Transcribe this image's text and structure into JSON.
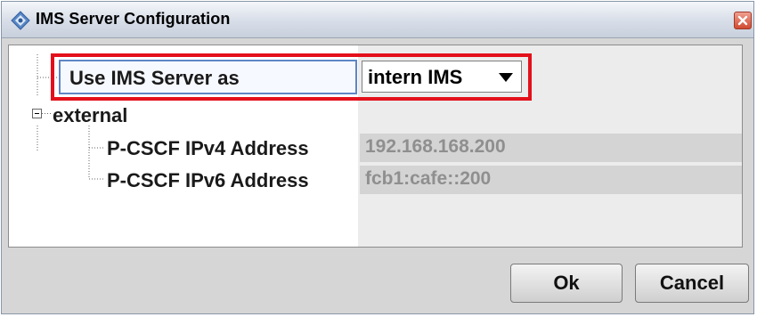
{
  "window": {
    "title": "IMS Server Configuration",
    "icon": "diamond-app-icon",
    "close_icon": "close-icon"
  },
  "tree": {
    "use_ims_label": "Use IMS Server as",
    "use_ims_value": "intern IMS",
    "external_label": "external",
    "pcscf_ipv4_label": "P-CSCF IPv4 Address",
    "pcscf_ipv4_value": "192.168.168.200",
    "pcscf_ipv6_label": "P-CSCF IPv6 Address",
    "pcscf_ipv6_value": "fcb1:cafe::200",
    "collapse_icon": "minus-box-icon"
  },
  "buttons": {
    "ok": "Ok",
    "cancel": "Cancel"
  },
  "colors": {
    "highlight": "#e3101b",
    "selection_border": "#5f86c6"
  }
}
